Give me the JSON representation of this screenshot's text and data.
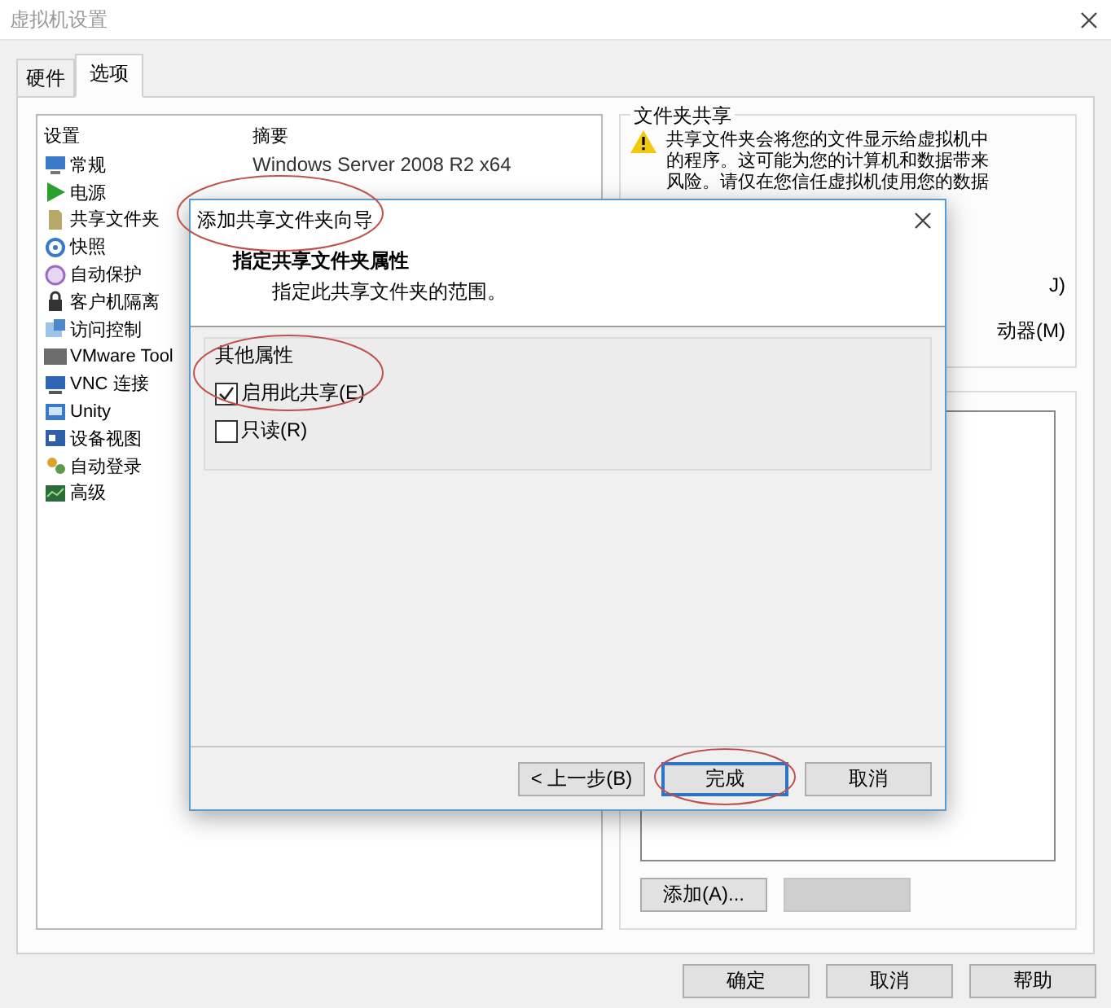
{
  "window": {
    "title": "虚拟机设置"
  },
  "tabs": [
    {
      "label": "硬件",
      "selected": false
    },
    {
      "label": "选项",
      "selected": true
    }
  ],
  "settings_list": {
    "columns": [
      "设置",
      "摘要"
    ],
    "items": [
      {
        "label": "常规",
        "summary": "Windows Server 2008 R2 x64"
      },
      {
        "label": "电源"
      },
      {
        "label": "共享文件夹"
      },
      {
        "label": "快照"
      },
      {
        "label": "自动保护"
      },
      {
        "label": "客户机隔离"
      },
      {
        "label": "访问控制"
      },
      {
        "label": "VMware Tool"
      },
      {
        "label": "VNC 连接"
      },
      {
        "label": "Unity"
      },
      {
        "label": "设备视图"
      },
      {
        "label": "自动登录"
      },
      {
        "label": "高级"
      }
    ]
  },
  "folder_sharing": {
    "title": "文件夹共享",
    "warning_lines": [
      "共享文件夹会将您的文件显示给虚拟机中",
      "的程序。这可能为您的计算机和数据带来",
      "风险。请仅在您信任虚拟机使用您的数据"
    ],
    "option_fragments": [
      "J)",
      "动器(M)"
    ]
  },
  "folders_group": {
    "add_button": "添加(A)..."
  },
  "footer_buttons": [
    "确定",
    "取消",
    "帮助"
  ],
  "wizard": {
    "title": "添加共享文件夹向导",
    "heading": "指定共享文件夹属性",
    "subheading": "指定此共享文件夹的范围。",
    "group": "其他属性",
    "options": [
      {
        "label": "启用此共享(E)",
        "checked": true
      },
      {
        "label": "只读(R)",
        "checked": false
      }
    ],
    "buttons": [
      {
        "label": "< 上一步(B)",
        "default": false
      },
      {
        "label": "完成",
        "default": true
      },
      {
        "label": "取消",
        "default": false
      }
    ]
  }
}
